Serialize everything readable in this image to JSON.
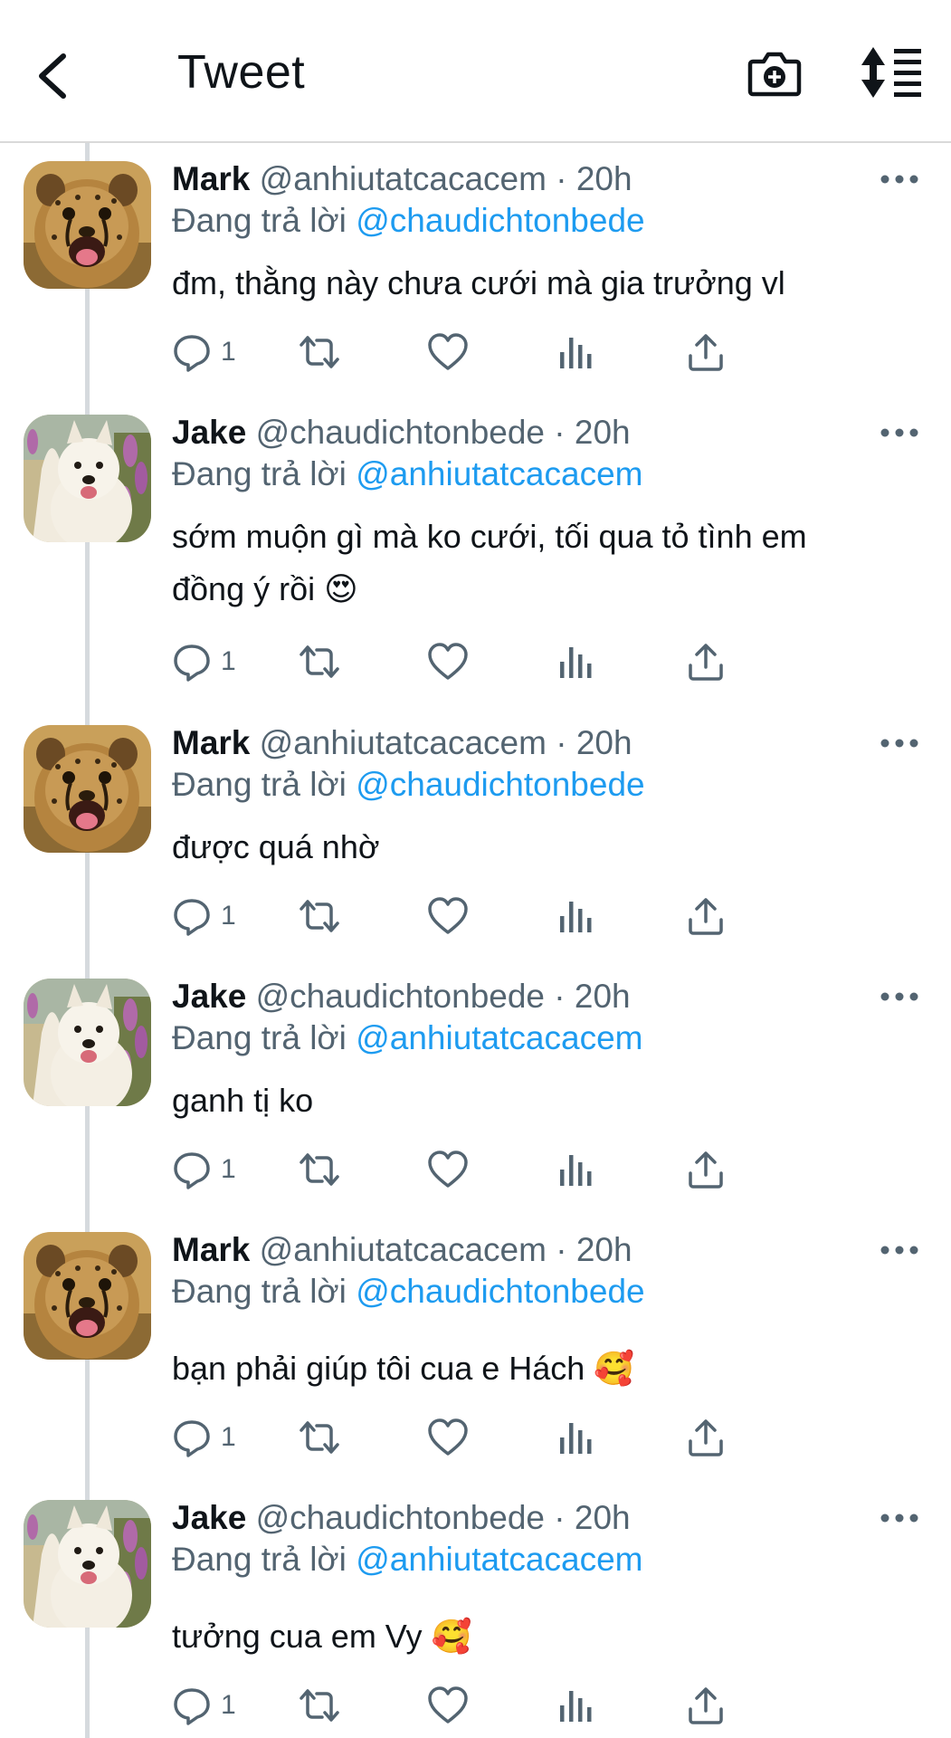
{
  "header": {
    "title": "Tweet",
    "back_icon": "chevron-left-icon",
    "camera_icon": "camera-plus-icon",
    "sort_icon": "sort-icon"
  },
  "colors": {
    "mention": "#1d9bf0",
    "secondary": "#536471",
    "primary_text": "#0f1419",
    "thread_line": "#d6dade"
  },
  "tweets": [
    {
      "name": "Mark",
      "handle": "@anhiutatcacacem",
      "dot": "·",
      "time": "20h",
      "reply_prefix": "Đang trả lời",
      "reply_to": "@chaudichtonbede",
      "text": "đm, thằng này chưa cưới mà gia trưởng vl",
      "reply_count": "1",
      "avatar": "cheetah-cub"
    },
    {
      "name": "Jake",
      "handle": "@chaudichtonbede",
      "dot": "·",
      "time": "20h",
      "reply_prefix": "Đang trả lời",
      "reply_to": "@anhiutatcacacem",
      "text": "sớm muộn gì mà ko cưới, tối qua tỏ tình em đồng ý rồi 😍",
      "reply_count": "1",
      "avatar": "white-dog"
    },
    {
      "name": "Mark",
      "handle": "@anhiutatcacacem",
      "dot": "·",
      "time": "20h",
      "reply_prefix": "Đang trả lời",
      "reply_to": "@chaudichtonbede",
      "text": "được quá nhờ",
      "reply_count": "1",
      "avatar": "cheetah-cub"
    },
    {
      "name": "Jake",
      "handle": "@chaudichtonbede",
      "dot": "·",
      "time": "20h",
      "reply_prefix": "Đang trả lời",
      "reply_to": "@anhiutatcacacem",
      "text": "ganh tị ko",
      "reply_count": "1",
      "avatar": "white-dog"
    },
    {
      "name": "Mark",
      "handle": "@anhiutatcacacem",
      "dot": "·",
      "time": "20h",
      "reply_prefix": "Đang trả lời",
      "reply_to": "@chaudichtonbede",
      "text": "bạn phải giúp tôi cua e Hách 🥰",
      "reply_count": "1",
      "avatar": "cheetah-cub"
    },
    {
      "name": "Jake",
      "handle": "@chaudichtonbede",
      "dot": "·",
      "time": "20h",
      "reply_prefix": "Đang trả lời",
      "reply_to": "@anhiutatcacacem",
      "text": "tưởng cua em Vy 🥰",
      "reply_count": "1",
      "avatar": "white-dog"
    }
  ]
}
